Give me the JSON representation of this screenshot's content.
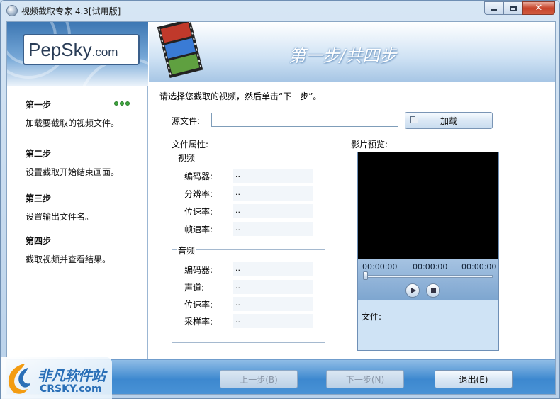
{
  "window": {
    "title": "视频截取专家 4.3[试用版]",
    "minimize_icon": "minimize-icon",
    "maximize_icon": "maximize-icon",
    "close_icon": "close-icon",
    "close_glyph": "✕"
  },
  "logo": {
    "brand": "PepSky",
    "suffix": ".com"
  },
  "steps": [
    {
      "title": "第一步",
      "desc": "加载要截取的视频文件。",
      "active": true
    },
    {
      "title": "第二步",
      "desc": "设置截取开始结束画面。",
      "active": false
    },
    {
      "title": "第三步",
      "desc": "设置输出文件名。",
      "active": false
    },
    {
      "title": "第四步",
      "desc": "截取视频并查看结果。",
      "active": false
    }
  ],
  "header": {
    "title": "第一步/共四步"
  },
  "main": {
    "instruction": "请选择您截取的视频，然后单击“下一步”。",
    "source_label": "源文件:",
    "source_value": "",
    "load_button": "加载",
    "properties_label": "文件属性:",
    "video_group": {
      "title": "视频",
      "rows": [
        {
          "name": "编码器:",
          "value": ".."
        },
        {
          "name": "分辨率:",
          "value": ".."
        },
        {
          "name": "位速率:",
          "value": ".."
        },
        {
          "name": "帧速率:",
          "value": ".."
        }
      ]
    },
    "audio_group": {
      "title": "音频",
      "rows": [
        {
          "name": "编码器:",
          "value": ".."
        },
        {
          "name": "声道:",
          "value": ".."
        },
        {
          "name": "位速率:",
          "value": ".."
        },
        {
          "name": "采样率:",
          "value": ".."
        }
      ]
    }
  },
  "preview": {
    "label": "影片预览:",
    "time_start": "00:00:00",
    "time_current": "00:00:00",
    "time_end": "00:00:00",
    "position": 0,
    "file_label": "文件:"
  },
  "footer": {
    "prev": "上一步(B)",
    "next": "下一步(N)",
    "exit": "退出(E)"
  },
  "watermark": {
    "cn": "非凡软件站",
    "en": "CRSKY.com"
  },
  "colors": {
    "accent": "#3d88cf",
    "active_dot": "#3fa83f",
    "video_bg": "#000000"
  }
}
